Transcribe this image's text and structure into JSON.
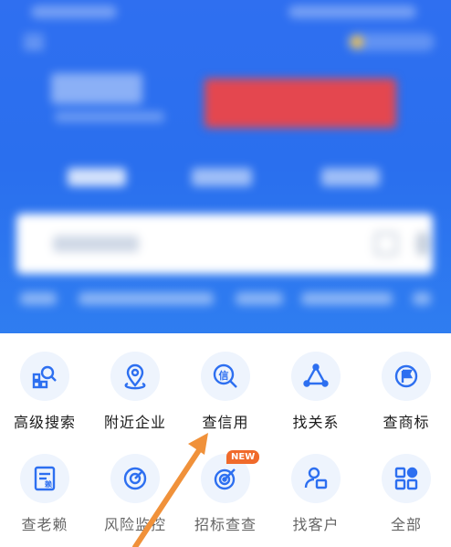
{
  "colors": {
    "header_blue": "#2a6fee",
    "icon_blue": "#2d6ff0",
    "icon_bg": "#eef4fd",
    "arrow_orange": "#f0913a",
    "new_badge": "#f06a2b"
  },
  "grid": {
    "row1": [
      {
        "label": "高级搜索",
        "icon": "advanced-search-icon"
      },
      {
        "label": "附近企业",
        "icon": "location-pin-icon"
      },
      {
        "label": "查信用",
        "icon": "credit-search-icon"
      },
      {
        "label": "找关系",
        "icon": "relation-graph-icon"
      },
      {
        "label": "查商标",
        "icon": "trademark-flag-icon"
      }
    ],
    "row2": [
      {
        "label": "查老赖",
        "icon": "debtor-document-icon"
      },
      {
        "label": "风险监控",
        "icon": "risk-radar-icon"
      },
      {
        "label": "招标查查",
        "icon": "bidding-target-icon",
        "badge": "NEW"
      },
      {
        "label": "找客户",
        "icon": "customer-card-icon"
      },
      {
        "label": "全部",
        "icon": "all-apps-icon"
      }
    ]
  }
}
